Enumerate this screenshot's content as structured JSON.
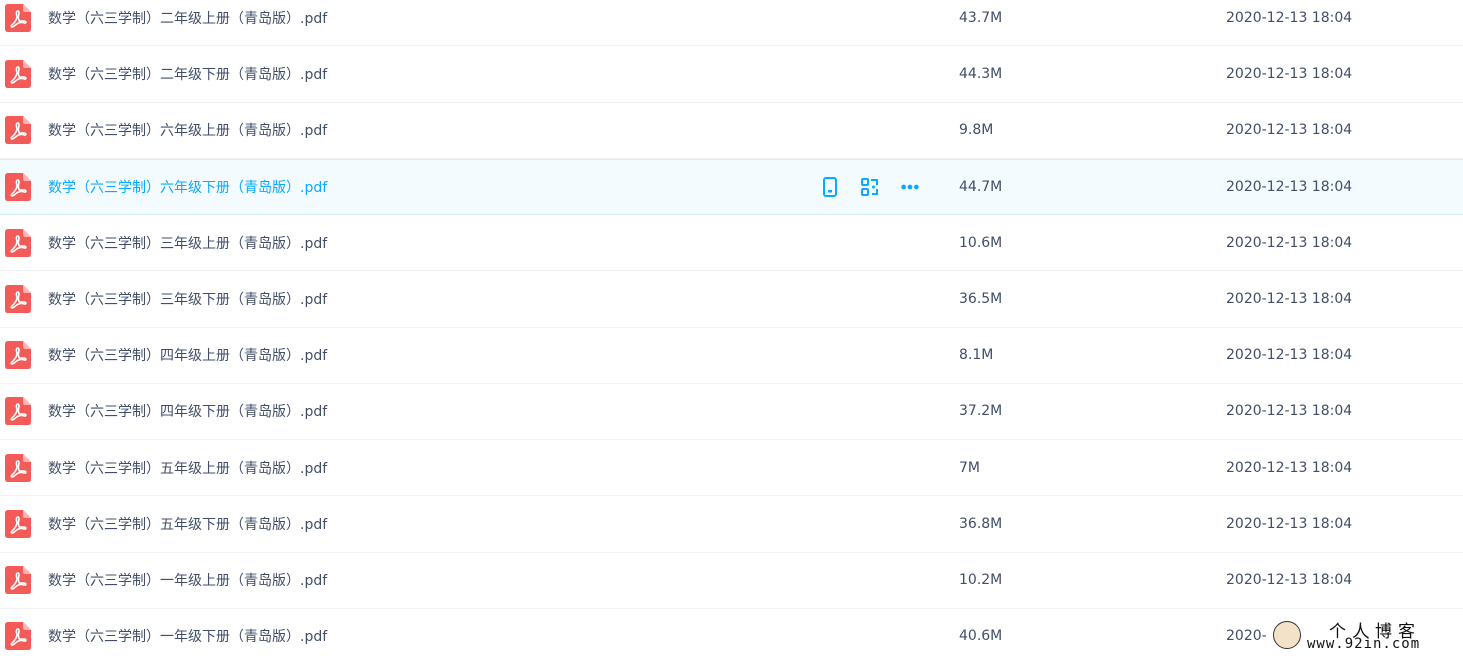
{
  "files": [
    {
      "name": "数学（六三学制）二年级上册（青岛版）.pdf",
      "size": "43.7M",
      "date": "2020-12-13 18:04"
    },
    {
      "name": "数学（六三学制）二年级下册（青岛版）.pdf",
      "size": "44.3M",
      "date": "2020-12-13 18:04"
    },
    {
      "name": "数学（六三学制）六年级上册（青岛版）.pdf",
      "size": "9.8M",
      "date": "2020-12-13 18:04"
    },
    {
      "name": "数学（六三学制）六年级下册（青岛版）.pdf",
      "size": "44.7M",
      "date": "2020-12-13 18:04"
    },
    {
      "name": "数学（六三学制）三年级上册（青岛版）.pdf",
      "size": "10.6M",
      "date": "2020-12-13 18:04"
    },
    {
      "name": "数学（六三学制）三年级下册（青岛版）.pdf",
      "size": "36.5M",
      "date": "2020-12-13 18:04"
    },
    {
      "name": "数学（六三学制）四年级上册（青岛版）.pdf",
      "size": "8.1M",
      "date": "2020-12-13 18:04"
    },
    {
      "name": "数学（六三学制）四年级下册（青岛版）.pdf",
      "size": "37.2M",
      "date": "2020-12-13 18:04"
    },
    {
      "name": "数学（六三学制）五年级上册（青岛版）.pdf",
      "size": "7M",
      "date": "2020-12-13 18:04"
    },
    {
      "name": "数学（六三学制）五年级下册（青岛版）.pdf",
      "size": "36.8M",
      "date": "2020-12-13 18:04"
    },
    {
      "name": "数学（六三学制）一年级上册（青岛版）.pdf",
      "size": "10.2M",
      "date": "2020-12-13 18:04"
    },
    {
      "name": "数学（六三学制）一年级下册（青岛版）.pdf",
      "size": "40.6M",
      "date": "2020-"
    }
  ],
  "hovered_row": 3,
  "icons": {
    "file": "pdf-icon",
    "actions": [
      "phone-icon",
      "share-icon",
      "more-icon"
    ]
  },
  "colors": {
    "pdf_red": "#f35a58",
    "accent": "#09aaff",
    "text": "#424e67",
    "hover_bg": "#f4fbff"
  },
  "watermark": {
    "title": "个人博客",
    "url": "www.92in.com"
  }
}
